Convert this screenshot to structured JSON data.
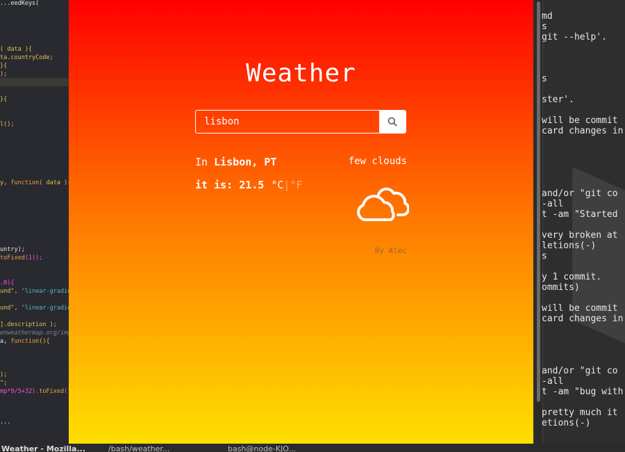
{
  "editor": {
    "lines": [
      {
        "segments": [
          {
            "t": "...eedKeys(",
            "c": "white"
          }
        ]
      },
      {
        "segments": [
          {
            "t": "( data ){",
            "c": "yel"
          }
        ]
      },
      {
        "segments": [
          {
            "t": "ta.countryCode;",
            "c": "yel"
          }
        ]
      },
      {
        "segments": [
          {
            "t": "}{",
            "c": "yel"
          }
        ]
      },
      {
        "segments": [
          {
            "t": ");",
            "c": "yel"
          }
        ]
      },
      {
        "segments": [
          {
            "t": "}{",
            "c": "yel"
          }
        ]
      },
      {
        "segments": [
          {
            "t": "l();",
            "c": "yel"
          }
        ]
      },
      {
        "segments": [
          {
            "t": "y, ",
            "c": "yel"
          },
          {
            "t": "function",
            "c": "org"
          },
          {
            "t": "( data ){",
            "c": "yel"
          }
        ]
      },
      {
        "segments": [
          {
            "t": "untry);",
            "c": "white"
          }
        ]
      },
      {
        "segments": [
          {
            "t": "toFixed",
            "c": "org"
          },
          {
            "t": "(1));",
            "c": "mag"
          }
        ]
      },
      {
        "segments": [
          {
            "t": ".0){",
            "c": "mag"
          }
        ]
      },
      {
        "segments": [
          {
            "t": "und\", ",
            "c": "yel"
          },
          {
            "t": "\"linear-gradien",
            "c": "cyan"
          }
        ]
      },
      {
        "segments": [
          {
            "t": "und\", ",
            "c": "yel"
          },
          {
            "t": "\"linear-gradien",
            "c": "cyan"
          }
        ]
      },
      {
        "segments": [
          {
            "t": "].description );",
            "c": "yel"
          }
        ]
      },
      {
        "segments": [
          {
            "t": "enweathermap.org/img",
            "c": "gray"
          }
        ]
      },
      {
        "segments": [
          {
            "t": "a, ",
            "c": "white"
          },
          {
            "t": "function",
            "c": "org"
          },
          {
            "t": "(){",
            "c": "yel"
          }
        ]
      },
      {
        "segments": [
          {
            "t": ");",
            "c": "yel"
          }
        ]
      },
      {
        "segments": [
          {
            "t": "\";",
            "c": "yel"
          }
        ]
      },
      {
        "segments": [
          {
            "t": "mp*9/5+32).",
            "c": "mag"
          },
          {
            "t": "toFixed",
            "c": "org"
          },
          {
            "t": "(1)",
            "c": "mag"
          }
        ]
      },
      {
        "segments": [
          {
            "t": "...",
            "c": "white"
          }
        ]
      }
    ]
  },
  "terminal": {
    "lines": [
      "md",
      "s",
      "git --help'.",
      "s",
      "ster'.",
      " will be commit",
      "card changes in",
      " and/or \"git co",
      "-all",
      "t -am \"Started",
      " very broken at",
      "letions(-)",
      "s",
      "y 1 commit.",
      "ommits)",
      " will be commit",
      "card changes in",
      " and/or \"git co",
      "-all",
      "t -am \"bug with",
      " pretty much it",
      "etions(-)"
    ]
  },
  "app": {
    "title": "Weather",
    "search": {
      "value": "lisbon",
      "placeholder": ""
    },
    "location_prefix": "In ",
    "location": "Lisbon, PT",
    "description": "few clouds",
    "temp_prefix": "it is: ",
    "temp_value": "21.5",
    "unit_c": "°C",
    "unit_sep": "|",
    "unit_f": "°F",
    "credit": "By Alec",
    "icon": "cloud-icon",
    "gradient": [
      "#ff0000",
      "#ff7a00",
      "#ffe000"
    ]
  },
  "taskbar": {
    "items": [
      "Weather - Mozilla...",
      "/bash/weather...",
      "bash@node-KJO..."
    ]
  }
}
